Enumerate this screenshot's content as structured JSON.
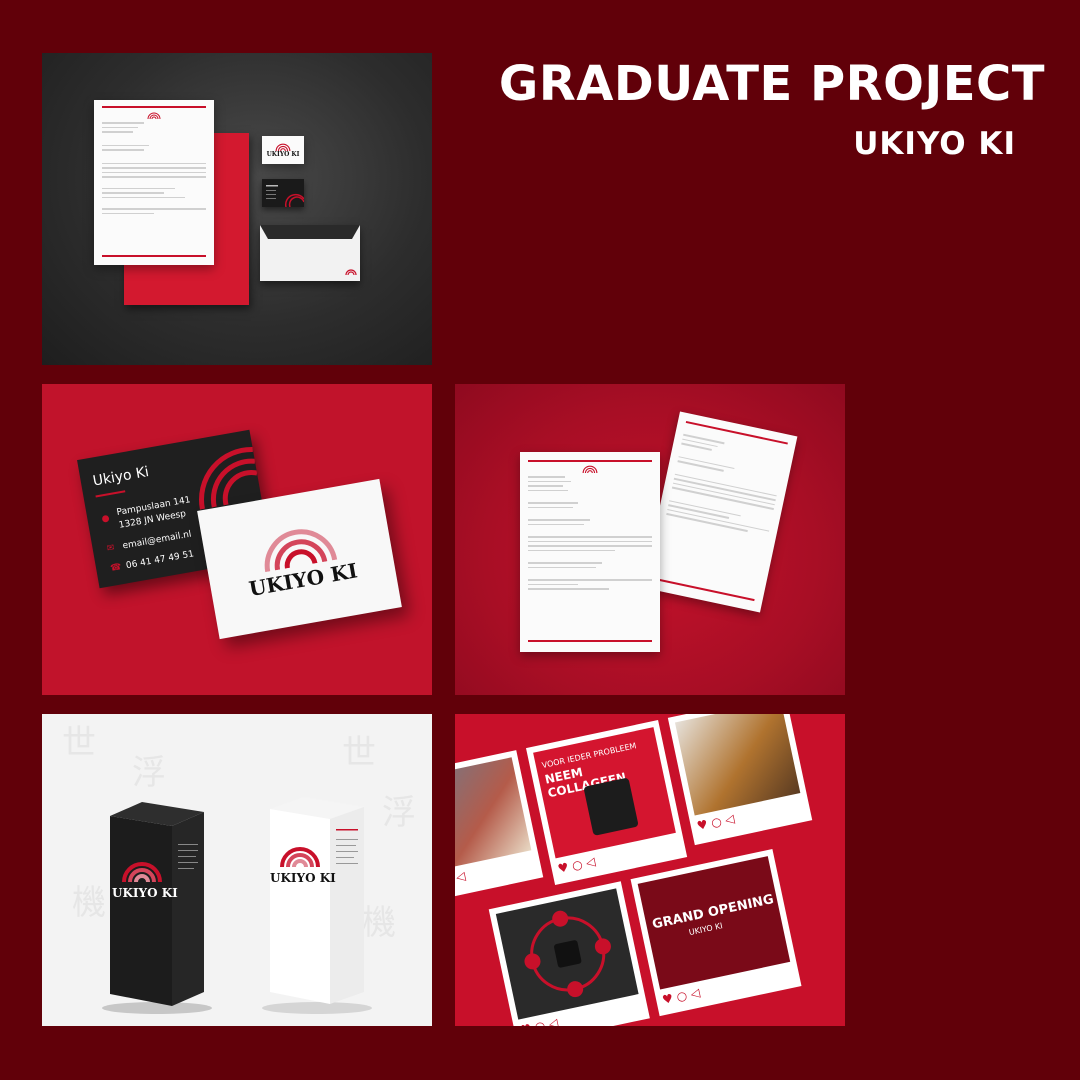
{
  "header": {
    "title": "GRADUATE PROJECT",
    "subtitle": "UKIYO KI"
  },
  "colors": {
    "background": "#610009",
    "brand_red": "#c8102a",
    "dark": "#222222"
  },
  "brand": {
    "logo_text": "UKIYO KI"
  },
  "business_card": {
    "name": "Ukiyo Ki",
    "address_line1": "Pampuslaan 141",
    "address_line2": "1328 JN Weesp",
    "email": "email@email.nl",
    "phone": "06 41 47 49 51"
  },
  "social_posts": {
    "post1_line1": "VOOR IEDER PROBLEEM",
    "post1_line2": "NEEM COLLAGEEN",
    "post2_line1": "GRAND OPENING",
    "post2_line2": "UKIYO KI"
  },
  "panels": [
    {
      "name": "stationery-mockup"
    },
    {
      "name": "business-card-mockup"
    },
    {
      "name": "letterhead-mockup"
    },
    {
      "name": "packaging-mockup"
    },
    {
      "name": "social-media-mockup"
    }
  ]
}
